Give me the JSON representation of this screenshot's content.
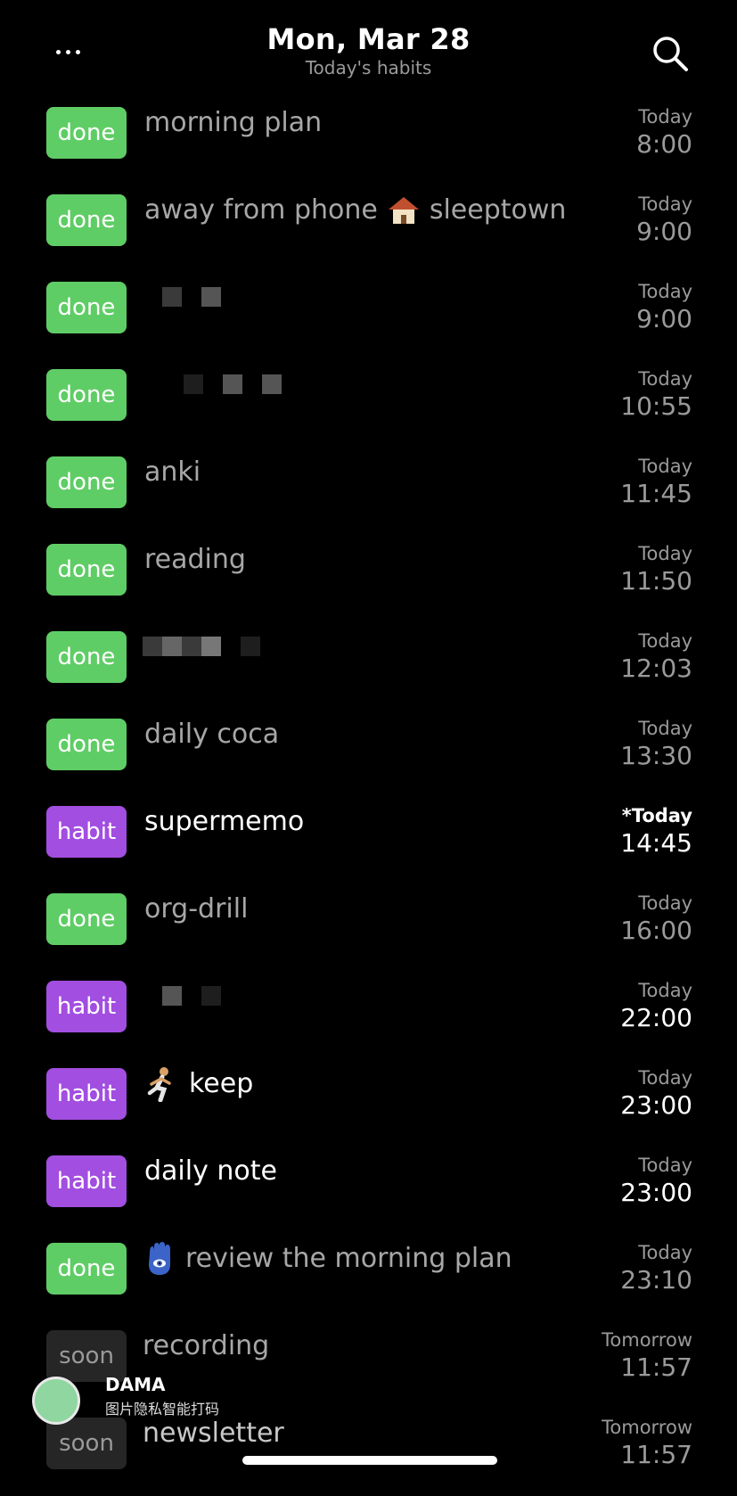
{
  "header": {
    "title": "Mon, Mar 28",
    "subtitle": "Today's habits"
  },
  "icons": {
    "menu": "more-dots-icon",
    "search": "search-icon"
  },
  "items": [
    {
      "status": "done",
      "name": "morning plan",
      "day": "Today",
      "time": "8:00"
    },
    {
      "status": "done",
      "name": "away from phone",
      "name2": "sleeptown",
      "day": "Today",
      "time": "9:00"
    },
    {
      "status": "done",
      "name": "",
      "day": "Today",
      "time": "9:00"
    },
    {
      "status": "done",
      "name": "",
      "day": "Today",
      "time": "10:55"
    },
    {
      "status": "done",
      "name": "anki",
      "day": "Today",
      "time": "11:45"
    },
    {
      "status": "done",
      "name": "reading",
      "day": "Today",
      "time": "11:50"
    },
    {
      "status": "done",
      "name": "",
      "day": "Today",
      "time": "12:03"
    },
    {
      "status": "done",
      "name": "daily coca",
      "day": "Today",
      "time": "13:30"
    },
    {
      "status": "habit",
      "name": "supermemo",
      "day": "*Today",
      "time": "14:45"
    },
    {
      "status": "done",
      "name": "org-drill",
      "day": "Today",
      "time": "16:00"
    },
    {
      "status": "habit",
      "name": "",
      "day": "Today",
      "time": "22:00"
    },
    {
      "status": "habit",
      "name": "keep",
      "day": "Today",
      "time": "23:00"
    },
    {
      "status": "habit",
      "name": "daily note",
      "day": "Today",
      "time": "23:00"
    },
    {
      "status": "done",
      "name": "review the morning plan",
      "day": "Today",
      "time": "23:10"
    },
    {
      "status": "soon",
      "name": "recording",
      "day": "Tomorrow",
      "time": "11:57"
    },
    {
      "status": "soon",
      "name": "newsletter",
      "day": "Tomorrow",
      "time": "11:57"
    }
  ],
  "watermark": {
    "title": "DAMA",
    "subtitle": "图片隐私智能打码"
  },
  "colors": {
    "done": "#5fcd65",
    "habit": "#a24ee0",
    "soon": "#262626",
    "background": "#000000"
  }
}
